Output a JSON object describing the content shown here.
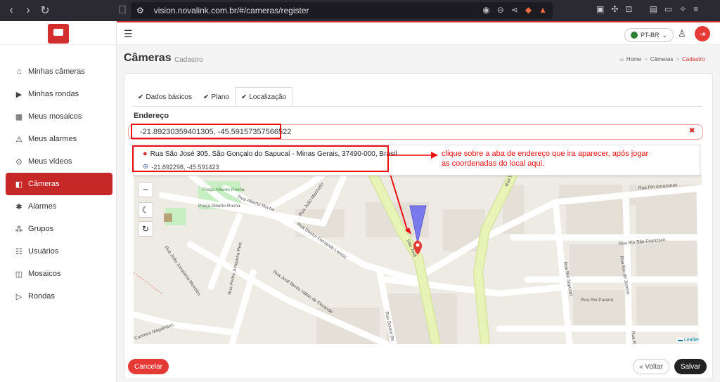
{
  "browser": {
    "url": "vision.novalink.com.br/#/cameras/register"
  },
  "sidebar": {
    "items": [
      {
        "label": "Minhas câmeras",
        "icon": "home-icon"
      },
      {
        "label": "Minhas rondas",
        "icon": "play-square-icon"
      },
      {
        "label": "Meus mosaicos",
        "icon": "grid-icon"
      },
      {
        "label": "Meus alarmes",
        "icon": "alarm-icon"
      },
      {
        "label": "Meus vídeos",
        "icon": "play-circle-icon"
      },
      {
        "label": "Câmeras",
        "icon": "camera-icon",
        "active": true
      },
      {
        "label": "Alarmes",
        "icon": "alarm-light-icon"
      },
      {
        "label": "Grupos",
        "icon": "group-icon"
      },
      {
        "label": "Usuários",
        "icon": "users-icon"
      },
      {
        "label": "Mosaicos",
        "icon": "mosaic-icon"
      },
      {
        "label": "Rondas",
        "icon": "rounds-icon"
      }
    ]
  },
  "header": {
    "language": "PT-BR"
  },
  "page": {
    "title": "Câmeras",
    "subtitle": "Cadastro",
    "breadcrumb": [
      "Home",
      "Câmeras",
      "Cadastro"
    ]
  },
  "tabs": [
    {
      "label": "Dados básicos",
      "active": false
    },
    {
      "label": "Plano",
      "active": false
    },
    {
      "label": "Localização",
      "active": true
    }
  ],
  "address": {
    "label": "Endereço",
    "value": "-21.89230359401305, -45.59157357566522"
  },
  "suggestion": {
    "address": "Rua São José 305, São Gonçalo do Sapucaí - Minas Gerais, 37490-000, Brasil",
    "coords": "-21.892298, -45.591423"
  },
  "annotation": {
    "text": "clique sobre a aba de endereço que ira aparecer, após jogar as coordenadas do local aqui."
  },
  "map": {
    "streets": [
      "Praça Alberto Rocha",
      "Rua Alberto Rocha",
      "Praça Alberto Rocha",
      "Rua João Machado",
      "Rua Doutor Fernando Lemos",
      "Rua João Junqueira Meireles",
      "Rua Pedro Junqueira Reis",
      "Rua José Bento Vallas de Rezende",
      "Rua Doutor Be",
      "Rua Rio Amazonas",
      "Rua Rio São Francisco",
      "Rua Rio Sapucaí",
      "Rua Rio de Janeiro",
      "Rua Rio Paraná",
      "Rua Rio Be",
      "Carneiro Magalhães",
      "Rua D",
      "São José"
    ],
    "attribution": "Leaflet",
    "colors": {
      "main_road": "#e8f3b8",
      "background": "#eeeae4",
      "marker": "#e53935",
      "camera_cone": "#6f6ff0"
    }
  },
  "actions": {
    "cancel": "Cancelar",
    "back": "« Voltar",
    "save": "Salvar"
  }
}
